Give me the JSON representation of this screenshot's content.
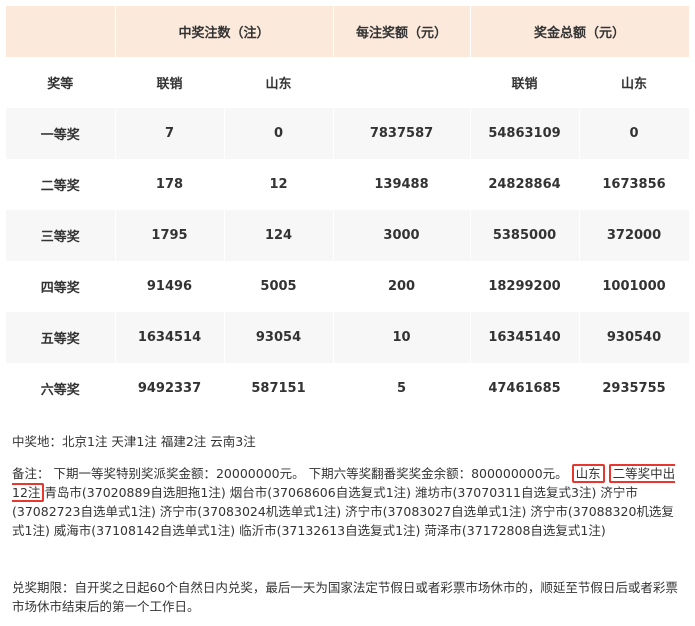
{
  "table": {
    "header": {
      "prize_level": "奖等",
      "winning_bets": "中奖注数（注）",
      "per_bet_prize": "每注奖额（元）",
      "total_prize": "奖金总额（元）",
      "national": "联销",
      "shandong": "山东"
    },
    "rows": [
      {
        "level": "一等奖",
        "national_count": "7",
        "shandong_count": "0",
        "per_bet": "7837587",
        "national_total": "54863109",
        "shandong_total": "0"
      },
      {
        "level": "二等奖",
        "national_count": "178",
        "shandong_count": "12",
        "per_bet": "139488",
        "national_total": "24828864",
        "shandong_total": "1673856"
      },
      {
        "level": "三等奖",
        "national_count": "1795",
        "shandong_count": "124",
        "per_bet": "3000",
        "national_total": "5385000",
        "shandong_total": "372000"
      },
      {
        "level": "四等奖",
        "national_count": "91496",
        "shandong_count": "5005",
        "per_bet": "200",
        "national_total": "18299200",
        "shandong_total": "1001000"
      },
      {
        "level": "五等奖",
        "national_count": "1634514",
        "shandong_count": "93054",
        "per_bet": "10",
        "national_total": "16345140",
        "shandong_total": "930540"
      },
      {
        "level": "六等奖",
        "national_count": "9492337",
        "shandong_count": "587151",
        "per_bet": "5",
        "national_total": "47461685",
        "shandong_total": "2935755"
      }
    ]
  },
  "notes": {
    "winners_location": "中奖地：北京1注 天津1注 福建2注 云南3注",
    "remark_prefix": "备注：  下期一等奖特别奖派奖金额：20000000元。 下期六等奖翻番奖奖金余额：800000000元。",
    "remark_hl1": "山东",
    "remark_hl2": "二等奖中出12注",
    "remark_suffix": "青岛市(37020889自选胆拖1注) 烟台市(37068606自选复式1注) 潍坊市(37070311自选复式3注) 济宁市(37082723自选单式1注) 济宁市(37083024机选单式1注) 济宁市(37083027自选单式1注) 济宁市(37088320机选复式1注) 威海市(37108142自选单式1注) 临沂市(37132613自选复式1注) 菏泽市(37172808自选复式1注)",
    "redeem_period": "兑奖期限：自开奖之日起60个自然日内兑奖，最后一天为国家法定节假日或者彩票市场休市的，顺延至节假日后或者彩票市场休市结束后的第一个工作日。"
  },
  "colors": {
    "header_bg": "#fbe9dc",
    "stripe_bg": "#f7f7f7",
    "highlight_border": "#e8372e"
  }
}
